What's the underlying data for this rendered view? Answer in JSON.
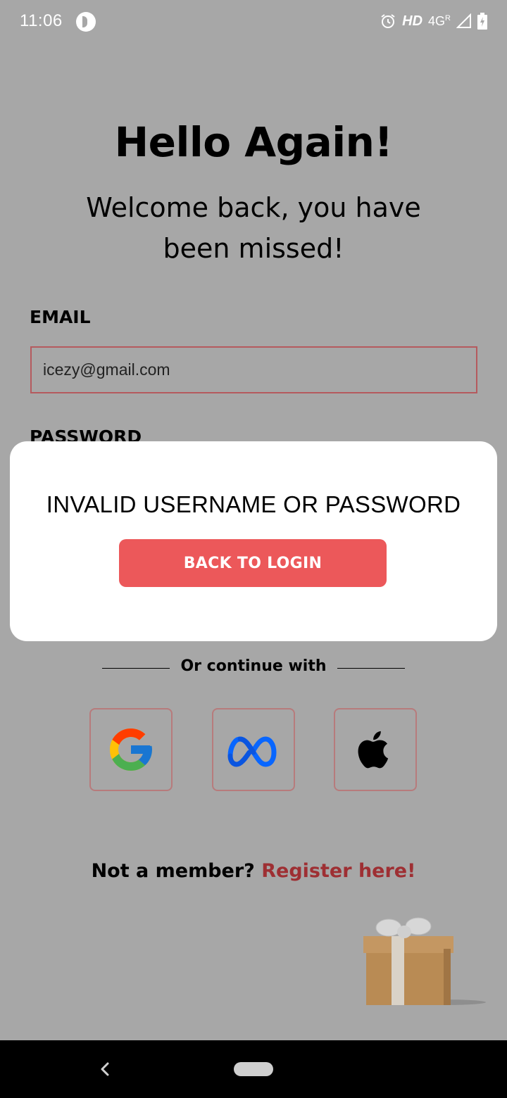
{
  "status_bar": {
    "time": "11:06",
    "hd": "HD",
    "network": "4G",
    "roaming": "R"
  },
  "login": {
    "title": "Hello Again!",
    "subtitle": "Welcome back, you have been missed!",
    "email_label": "EMAIL",
    "email_value": "icezy@gmail.com",
    "password_label": "PASSWORD",
    "divider_text": "Or continue with",
    "social": [
      "google",
      "meta",
      "apple"
    ],
    "register_prompt": "Not a member?",
    "register_link": "Register here!"
  },
  "modal": {
    "message": "INVALID USERNAME OR PASSWORD",
    "button_label": "BACK TO LOGIN"
  },
  "colors": {
    "accent": "#ec585a",
    "link": "#9e2f33",
    "overlay": "#a7a7a7"
  }
}
